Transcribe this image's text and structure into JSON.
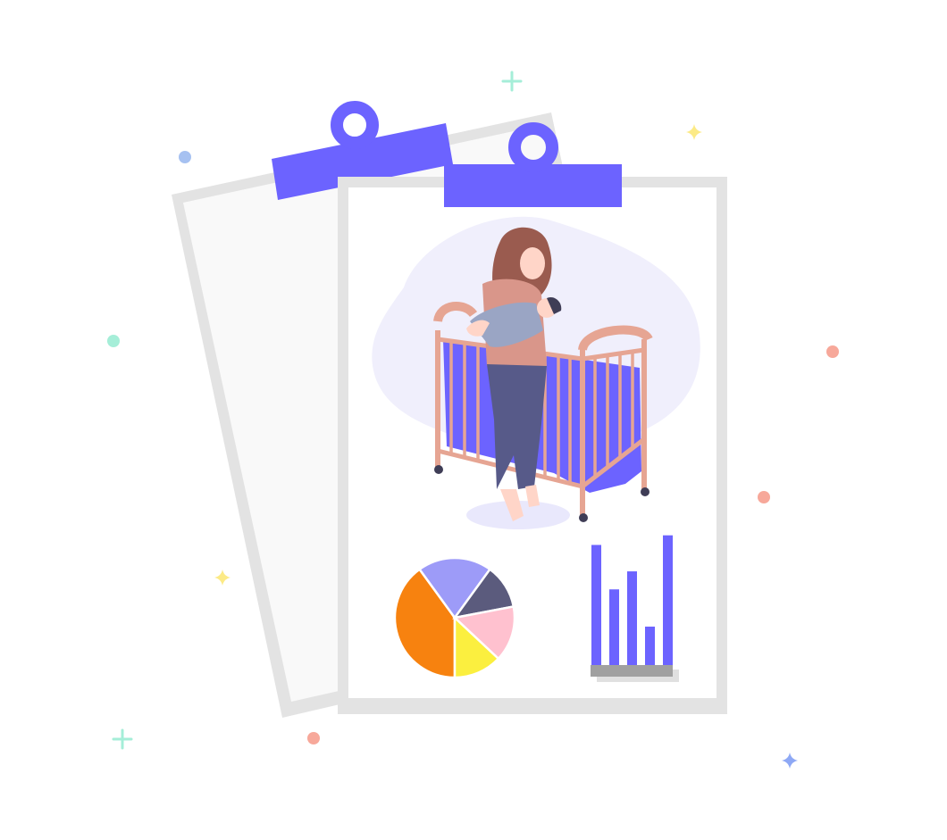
{
  "illustration": {
    "subject": "clipboard-report",
    "colors": {
      "accent": "#6c63ff",
      "paper": "#ffffff",
      "paper_back": "#f9f9f9",
      "border": "#e0e0e0",
      "blob": "#f0effc",
      "crib": "#e6a593",
      "hair": "#9a5b4f",
      "skin": "#ffd5c8",
      "top": "#d9968a",
      "pants": "#575a89",
      "baby": "#9aa5c4"
    }
  },
  "chart_data": [
    {
      "type": "pie",
      "slices": [
        {
          "value": 40,
          "color": "#f7820f"
        },
        {
          "value": 20,
          "color": "#9d9bf8"
        },
        {
          "value": 12,
          "color": "#5b5b7d"
        },
        {
          "value": 15,
          "color": "#ffc1cf"
        },
        {
          "value": 13,
          "color": "#fbef3f"
        }
      ]
    },
    {
      "type": "bar",
      "values": [
        100,
        63,
        78,
        32,
        108
      ],
      "color": "#6c63ff",
      "ylim": [
        0,
        110
      ]
    }
  ],
  "decorations": [
    {
      "kind": "plus",
      "color": "#a5eed8"
    },
    {
      "kind": "sparkle",
      "color": "#fcea86"
    },
    {
      "kind": "dot",
      "color": "#a6c1f1"
    },
    {
      "kind": "dot",
      "color": "#a5eed8"
    },
    {
      "kind": "dot",
      "color": "#f7a89a"
    },
    {
      "kind": "dot",
      "color": "#f7a89a"
    },
    {
      "kind": "sparkle",
      "color": "#fcea86"
    },
    {
      "kind": "plus",
      "color": "#a5eed8"
    },
    {
      "kind": "dot",
      "color": "#f7a89a"
    },
    {
      "kind": "sparkle",
      "color": "#8ea8f5"
    }
  ]
}
